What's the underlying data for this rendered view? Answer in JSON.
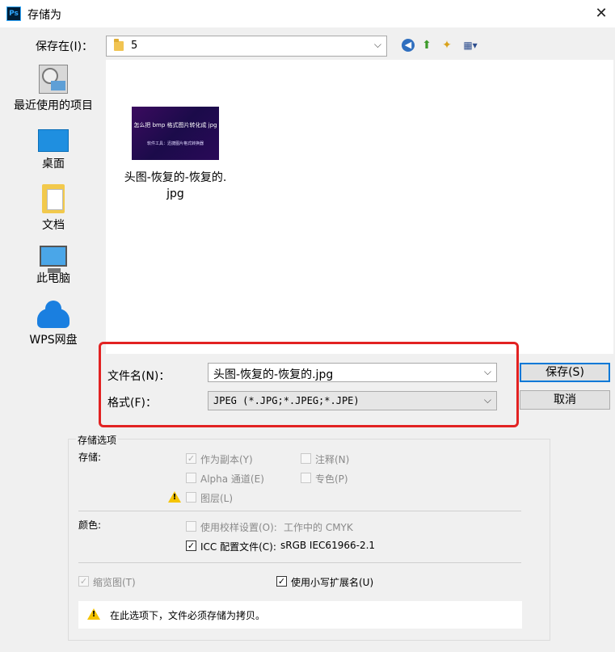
{
  "window": {
    "title": "存储为",
    "app_icon": "Ps",
    "close_label": "✕"
  },
  "toolbar": {
    "save_in_label": "保存在(I)：",
    "save_in_value": "5",
    "dropdown_arrow": "⌵",
    "view_arrow": "▾"
  },
  "places": [
    {
      "label": "最近使用的项目",
      "icon": "recent-places-icon"
    },
    {
      "label": "桌面",
      "icon": "desktop-icon"
    },
    {
      "label": "文档",
      "icon": "documents-icon"
    },
    {
      "label": "此电脑",
      "icon": "this-pc-icon"
    },
    {
      "label": "WPS网盘",
      "icon": "wps-cloud-icon"
    }
  ],
  "files": [
    {
      "name_line1": "头图-恢复的-恢复的.",
      "name_line2": "jpg",
      "thumb_title": "怎么把 bmp 格式图片转化成 jpg",
      "thumb_sub": "软件工具：迅捷图片格式转换器"
    }
  ],
  "form": {
    "filename_label": "文件名(N)：",
    "filename_value": "头图-恢复的-恢复的.jpg",
    "format_label": "格式(F)：",
    "format_value": "JPEG (*.JPG;*.JPEG;*.JPE)",
    "save_button": "保存(S)",
    "cancel_button": "取消"
  },
  "options": {
    "group_title": "存储选项",
    "storage_label": "存储:",
    "as_copy": {
      "label": "作为副本(Y)",
      "checked": true,
      "enabled": false
    },
    "notes": {
      "label": "注释(N)",
      "checked": false,
      "enabled": false
    },
    "alpha": {
      "label": "Alpha 通道(E)",
      "checked": false,
      "enabled": false
    },
    "spot": {
      "label": "专色(P)",
      "checked": false,
      "enabled": false
    },
    "layers": {
      "label": "图层(L)",
      "checked": false,
      "enabled": false
    },
    "color_label": "颜色:",
    "proof": {
      "label": "使用校样设置(O):",
      "value": "工作中的 CMYK",
      "checked": false,
      "enabled": false
    },
    "icc": {
      "label": "ICC 配置文件(C):",
      "value": "sRGB IEC61966-2.1",
      "checked": true,
      "enabled": true
    },
    "thumbnail": {
      "label": "缩览图(T)",
      "checked": true,
      "enabled": false
    },
    "lowercase_ext": {
      "label": "使用小写扩展名(U)",
      "checked": true,
      "enabled": true
    },
    "message": "在此选项下，文件必须存储为拷贝。",
    "warning_mark": "!",
    "check_mark": "✓"
  },
  "colors": {
    "highlight": "#e22222",
    "accent": "#0078d7",
    "warning": "#f5c400"
  }
}
